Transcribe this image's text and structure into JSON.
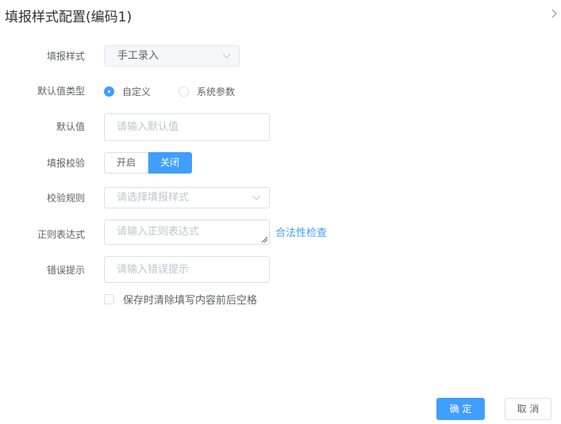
{
  "dialog": {
    "title": "填报样式配置(编码1)",
    "collapse_icon": "chevron-right-icon"
  },
  "form": {
    "fill_style": {
      "label": "填报样式",
      "value": "手工录入"
    },
    "default_type": {
      "label": "默认值类型",
      "options": [
        {
          "label": "自定义",
          "checked": true
        },
        {
          "label": "系统参数",
          "checked": false
        }
      ]
    },
    "default_value": {
      "label": "默认值",
      "placeholder": "请输入默认值"
    },
    "validation": {
      "label": "填报校验",
      "options": [
        {
          "label": "开启",
          "active": false
        },
        {
          "label": "关闭",
          "active": true
        }
      ]
    },
    "validation_rule": {
      "label": "校验规则",
      "placeholder": "请选择填报样式"
    },
    "regex": {
      "label": "正则表达式",
      "placeholder": "请输入正则表达式",
      "check_link": "合法性检查"
    },
    "error_hint": {
      "label": "错误提示",
      "placeholder": "请输入错误提示"
    },
    "trim_whitespace": {
      "label": "保存时清除填写内容前后空格",
      "checked": false
    }
  },
  "footer": {
    "confirm_label": "确 定",
    "cancel_label": "取 消"
  },
  "colors": {
    "primary": "#409eff",
    "border": "#dcdfe6",
    "placeholder": "#c0c4cc",
    "text": "#606266",
    "title": "#303133"
  }
}
